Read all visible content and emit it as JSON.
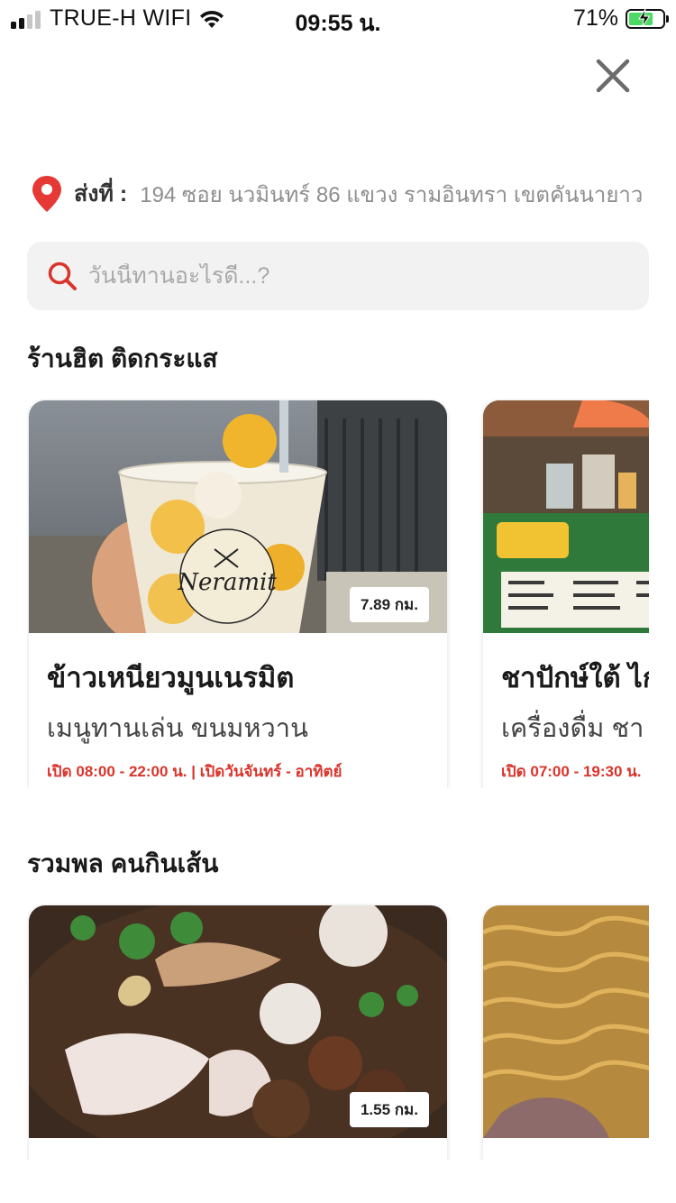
{
  "status_bar": {
    "carrier": "TRUE-H WIFI",
    "time": "09:55 น.",
    "battery_percent": "71%",
    "battery_level": 0.71,
    "signal_bars_on": 2
  },
  "header": {
    "close_icon": "close-icon"
  },
  "address": {
    "label": "ส่งที่ :",
    "value": "194 ซอย นวมินทร์ 86 แขวง รามอินทรา เขตคันนายาว",
    "icon": "location-pin-icon",
    "icon_color": "#e53935"
  },
  "search": {
    "placeholder": "วันนี้ทานอะไรดี...?",
    "value": "",
    "icon": "search-icon",
    "icon_color": "#d9342b"
  },
  "sections": [
    {
      "title": "ร้านฮิต ติดกระแส",
      "cards": [
        {
          "name": "ข้าวเหนียวมูนเนรมิต",
          "category": "เมนูทานเล่น ขนมหวาน",
          "hours": "เปิด 08:00 - 22:00 น. | เปิดวันจันทร์ - อาทิตย์",
          "distance": "7.89 กม.",
          "image_text": "Neramit"
        },
        {
          "name": "ชาปักษ์ใต้ ไก่ทอด",
          "category": "เครื่องดื่ม ชา กาแฟ",
          "hours": "เปิด 07:00 - 19:30 น.",
          "distance": ""
        }
      ]
    },
    {
      "title": "รวมพล คนกินเส้น",
      "cards": [
        {
          "name": "",
          "category": "",
          "hours": "",
          "distance": "1.55 กม."
        },
        {
          "name": "",
          "category": "",
          "hours": "",
          "distance": ""
        }
      ]
    }
  ],
  "colors": {
    "accent_red": "#d9342b",
    "battery_green": "#4cd964"
  }
}
